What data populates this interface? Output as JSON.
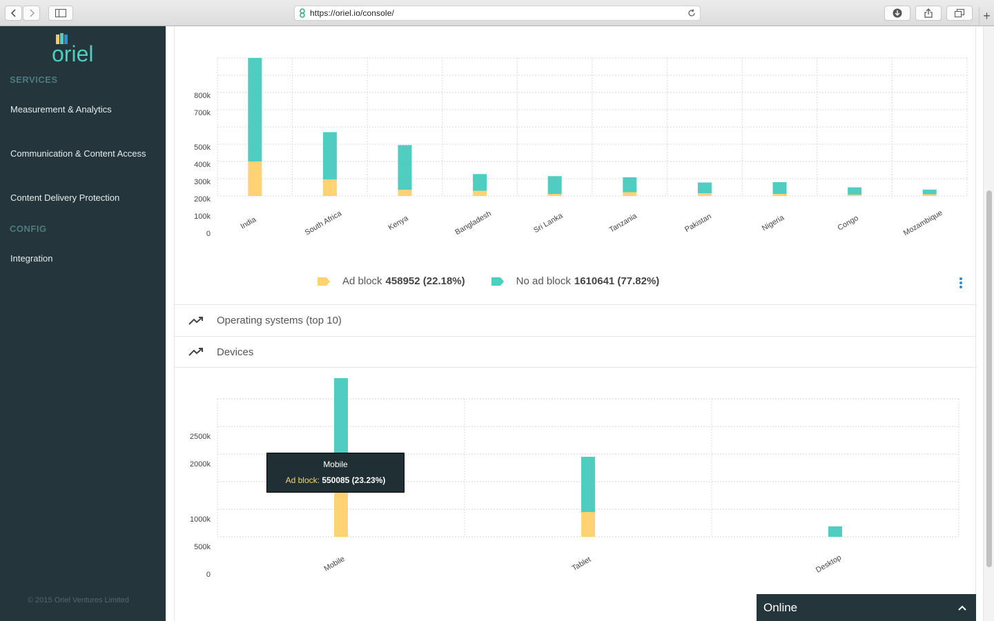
{
  "browser": {
    "url": "https://oriel.io/console/"
  },
  "sidebar": {
    "logo_text": "oriel",
    "sections": [
      {
        "label": "SERVICES"
      },
      {
        "label": "CONFIG"
      }
    ],
    "items": [
      {
        "label": "Measurement & Analytics"
      },
      {
        "label": "Communication & Content Access"
      },
      {
        "label": "Content Delivery Protection"
      },
      {
        "label": "Integration"
      }
    ],
    "copyright": "© 2015 Oriel Ventures Limited"
  },
  "colors": {
    "ad_block": "#ffd274",
    "no_ad_block": "#4ecdc0",
    "sidebar_bg": "#24363c",
    "accent": "#2a8fd4"
  },
  "countries_chart": {
    "legend": {
      "ad_block_label": "Ad block",
      "ad_block_value": "458952 (22.18%)",
      "no_ad_block_label": "No ad block",
      "no_ad_block_value": "1610641 (77.82%)"
    }
  },
  "sections": {
    "operating_systems": "Operating systems (top 10)",
    "devices": "Devices"
  },
  "tooltip": {
    "title": "Mobile",
    "label": "Ad block:",
    "value": "550085 (23.23%)"
  },
  "online_panel": {
    "label": "Online"
  },
  "chart_data": [
    {
      "type": "bar",
      "stacked": true,
      "categories": [
        "India",
        "South Africa",
        "Kenya",
        "Bangladesh",
        "Sri Lanka",
        "Tanzania",
        "Pakistan",
        "Nigeria",
        "Congo",
        "Mozambique"
      ],
      "series": [
        {
          "name": "Ad block",
          "values": [
            200000,
            95000,
            35000,
            30000,
            12000,
            22000,
            15000,
            12000,
            8000,
            10000
          ]
        },
        {
          "name": "No ad block",
          "values": [
            600000,
            275000,
            260000,
            97000,
            103000,
            86000,
            63000,
            68000,
            42000,
            27000
          ]
        }
      ],
      "yticks": [
        "0",
        "100k",
        "200k",
        "300k",
        "400k",
        "500k",
        "700k",
        "800k"
      ],
      "ylim": [
        0,
        800000
      ],
      "grid": true
    },
    {
      "type": "bar",
      "stacked": true,
      "categories": [
        "Mobile",
        "Tablet",
        "Desktop"
      ],
      "series": [
        {
          "name": "Ad block",
          "values": [
            1075000,
            450000,
            0
          ]
        },
        {
          "name": "No ad block",
          "values": [
            1800000,
            1000000,
            190000
          ]
        }
      ],
      "yticks": [
        "0",
        "500k",
        "1000k",
        "2000k",
        "2500k"
      ],
      "ylim": [
        0,
        2500000
      ],
      "grid": true
    }
  ]
}
